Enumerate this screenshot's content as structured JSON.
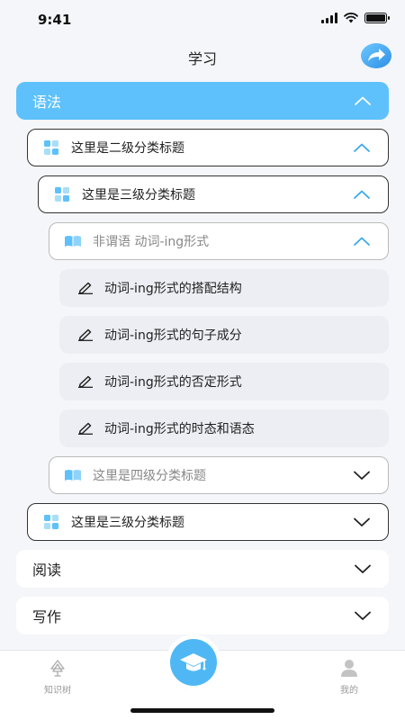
{
  "status": {
    "time": "9:41"
  },
  "header": {
    "title": "学习"
  },
  "sections": {
    "grammar": {
      "label": "语法"
    },
    "reading": {
      "label": "阅读"
    },
    "writing": {
      "label": "写作"
    }
  },
  "tree": {
    "level2": {
      "label": "这里是二级分类标题"
    },
    "level3": {
      "label": "这里是三级分类标题"
    },
    "level4_open": {
      "label": "非谓语 动词-ing形式"
    },
    "leaves": [
      {
        "label": "动词-ing形式的搭配结构"
      },
      {
        "label": "动词-ing形式的句子成分"
      },
      {
        "label": "动词-ing形式的否定形式"
      },
      {
        "label": "动词-ing形式的时态和语态"
      }
    ],
    "level4_closed": {
      "label": "这里是四级分类标题"
    },
    "level3_closed": {
      "label": "这里是三级分类标题"
    }
  },
  "tabbar": {
    "tabs": [
      {
        "label": "知识树"
      },
      {
        "label": "学习"
      },
      {
        "label": "我的"
      }
    ]
  },
  "colors": {
    "accent": "#5ec1fb",
    "text": "#222222",
    "muted": "#888888"
  }
}
